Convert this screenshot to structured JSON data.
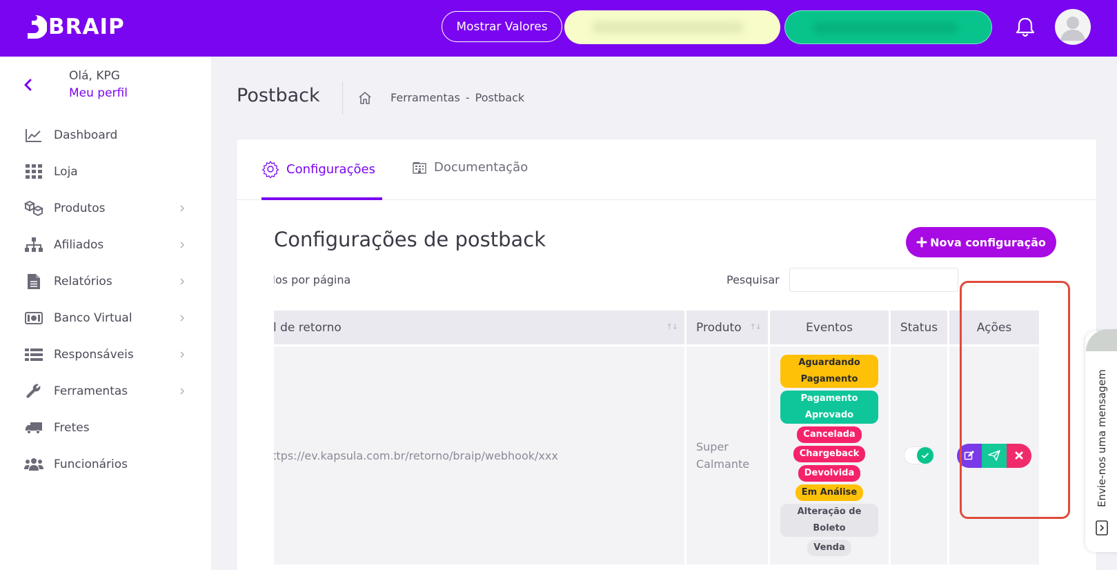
{
  "app": {
    "brand": "BRAIP"
  },
  "topbar": {
    "mostrar_valores_label": "Mostrar Valores",
    "icons": [
      "braip-logo-icon",
      "bell-icon",
      "avatar"
    ]
  },
  "sidebar": {
    "greeting": "Olá, KPG",
    "profile_link": "Meu perfil",
    "items": [
      {
        "label": "Dashboard",
        "icon": "chart-line-icon",
        "has_submenu": false
      },
      {
        "label": "Loja",
        "icon": "grid-icon",
        "has_submenu": false
      },
      {
        "label": "Produtos",
        "icon": "boxes-icon",
        "has_submenu": true
      },
      {
        "label": "Afiliados",
        "icon": "sitemap-icon",
        "has_submenu": true
      },
      {
        "label": "Relatórios",
        "icon": "document-icon",
        "has_submenu": true
      },
      {
        "label": "Banco Virtual",
        "icon": "money-icon",
        "has_submenu": true
      },
      {
        "label": "Responsáveis",
        "icon": "list-icon",
        "has_submenu": true
      },
      {
        "label": "Ferramentas",
        "icon": "wrench-icon",
        "has_submenu": true
      },
      {
        "label": "Fretes",
        "icon": "truck-icon",
        "has_submenu": false
      },
      {
        "label": "Funcionários",
        "icon": "users-icon",
        "has_submenu": false
      }
    ]
  },
  "header": {
    "title": "Postback",
    "breadcrumb": [
      "Ferramentas",
      "-",
      "Postback"
    ]
  },
  "tabs": [
    {
      "label": "Configurações",
      "active": true
    },
    {
      "label": "Documentação",
      "active": false
    }
  ],
  "section": {
    "title": "Configurações de postback",
    "new_button_label": "Nova configuração",
    "per_page_label": "ados por página",
    "search_label": "Pesquisar",
    "search_value": ""
  },
  "table": {
    "columns": [
      "Jrl de retorno",
      "Produto",
      "Eventos",
      "Status",
      "Ações"
    ],
    "rows": [
      {
        "url": "https://ev.kapsula.com.br/retorno/braip/webhook/xxx",
        "url_visible": "nttps://ev.kapsula.com.br/retorno/braip/webhook/xxx",
        "produto": [
          "Super",
          "Calmante"
        ],
        "eventos": [
          {
            "label": "Aguardando Pagamento",
            "lines": [
              "Aguardando",
              "Pagamento"
            ],
            "color": "#ffc107",
            "text_color": "#2b2b2b"
          },
          {
            "label": "Pagamento Aprovado",
            "lines": [
              "Pagamento",
              "Aprovado"
            ],
            "color": "#0fc69a",
            "text_color": "#ffffff"
          },
          {
            "label": "Cancelada",
            "lines": [
              "Cancelada"
            ],
            "color": "#f5226a",
            "text_color": "#ffffff"
          },
          {
            "label": "Chargeback",
            "lines": [
              "Chargeback"
            ],
            "color": "#f5226a",
            "text_color": "#ffffff"
          },
          {
            "label": "Devolvida",
            "lines": [
              "Devolvida"
            ],
            "color": "#f5226a",
            "text_color": "#ffffff"
          },
          {
            "label": "Em Análise",
            "lines": [
              "Em Análise"
            ],
            "color": "#ffc107",
            "text_color": "#2b2b2b"
          },
          {
            "label": "Alteração de Boleto",
            "lines": [
              "Alteração de",
              "Boleto"
            ],
            "color": "#e6e6ea",
            "text_color": "#4b4b58"
          },
          {
            "label": "Venda",
            "lines": [
              "Venda"
            ],
            "color": "#e6e6ea",
            "text_color": "#4b4b58"
          }
        ],
        "status_on": true,
        "actions": [
          "edit-icon",
          "send-icon",
          "delete-icon"
        ]
      }
    ]
  },
  "chat_widget": {
    "label": "Envie-nos uma mensagem"
  },
  "colors": {
    "brand_purple": "#7a05f0",
    "button_magenta": "#a80ae3",
    "highlight_red": "#df4a3a",
    "success_green": "#08c48c",
    "danger_pink": "#f02b6c"
  }
}
